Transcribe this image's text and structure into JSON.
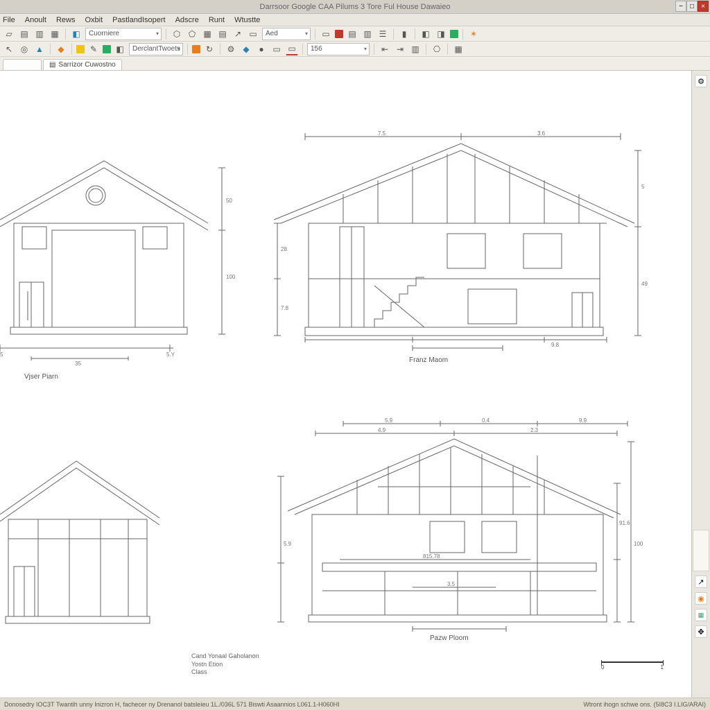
{
  "title": "Darrsoor Google CAA Pilums 3 Tore Ful House Dawaieo",
  "menu": [
    "File",
    "Anoult",
    "Rews",
    "Oxbit",
    "PastlandIsopert",
    "Adscre",
    "Runt",
    "Wtustte"
  ],
  "toolbar1": {
    "combo1": "Cuorniere",
    "combo2": "Aed"
  },
  "toolbar2": {
    "combo1": "DerclantTwoets",
    "combo2": "156"
  },
  "tabs": {
    "active": "Sarrizor Cuwostno"
  },
  "drawings": {
    "a": {
      "label": "Vjser Piarn",
      "dim_v_upper": "50",
      "dim_v_lower": "100",
      "dim_bl": "5",
      "dim_br": "5.Y",
      "dim_span": "35"
    },
    "b": {
      "label": "Franz Maom",
      "dim_top_l": "7.5",
      "dim_top_r": "3.6",
      "dim_v_l_upper": "28",
      "dim_v_l_lower": "7.8",
      "dim_v_r_upper": "5",
      "dim_v_r_lower": "49",
      "dim_bot": "9.8"
    },
    "c": {
      "label": ""
    },
    "d": {
      "label": "Pazw Ploom",
      "dim_top_1": "5.9",
      "dim_top_2": "0.4",
      "dim_top_3": "9.9",
      "dim_top_l": "4.9",
      "dim_top_r": "2.3",
      "dim_v_l": "5.9",
      "dim_v_r_upper": "91.6",
      "dim_v_r_lower": "100",
      "dim_int": "815.78",
      "dim_int2": "3.5"
    }
  },
  "footer": {
    "l1": "Cand Yonaal Gaholanon",
    "l2": "Yostn Etion",
    "l3": "Class"
  },
  "scale": {
    "a": "0",
    "b": "1"
  },
  "status": {
    "left": "Donosedry IOC3T Twantih unny Inizron H, fachecer ny Drenanol batsleieu 1L./036L  571 Biswti Asaannios  L061.1-H060HI",
    "right": "Wtront ihogn schwe ons. (5I8C3 I.LIG/ARAI)"
  }
}
